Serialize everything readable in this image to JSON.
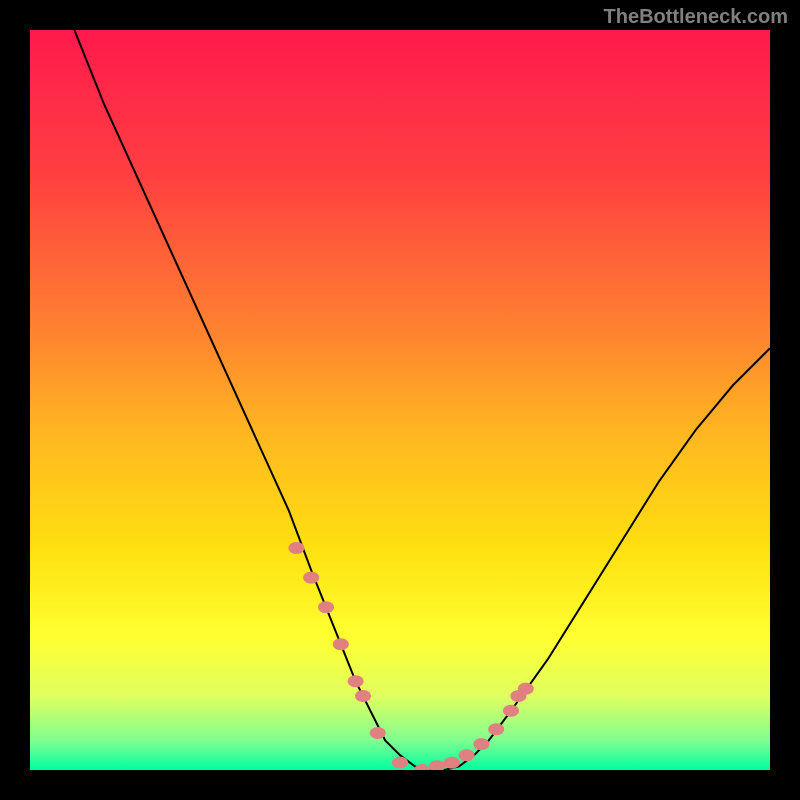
{
  "watermark": "TheBottleneck.com",
  "chart_data": {
    "type": "line",
    "title": "",
    "xlabel": "",
    "ylabel": "",
    "xlim": [
      0,
      100
    ],
    "ylim": [
      0,
      100
    ],
    "series": [
      {
        "name": "curve",
        "x": [
          6,
          10,
          15,
          20,
          25,
          30,
          35,
          38,
          40,
          42,
          44,
          46,
          48,
          50,
          52,
          54,
          56,
          58,
          60,
          62,
          65,
          70,
          75,
          80,
          85,
          90,
          95,
          100
        ],
        "y": [
          100,
          90,
          79,
          68,
          57,
          46,
          35,
          27,
          22,
          17,
          12,
          8,
          4,
          2,
          0.5,
          0,
          0,
          0.5,
          2,
          4,
          8,
          15,
          23,
          31,
          39,
          46,
          52,
          57
        ]
      }
    ],
    "highlights": {
      "name": "dotted-segments",
      "color": "#e08080",
      "x": [
        36,
        38,
        40,
        42,
        44,
        45,
        47,
        50,
        53,
        55,
        57,
        59,
        61,
        63,
        65,
        66,
        67
      ],
      "y": [
        30,
        26,
        22,
        17,
        12,
        10,
        5,
        1,
        0,
        0.5,
        1,
        2,
        3.5,
        5.5,
        8,
        10,
        11
      ]
    },
    "gradient_stops": [
      {
        "offset": 0.0,
        "color": "#ff1a4d"
      },
      {
        "offset": 0.2,
        "color": "#ff4040"
      },
      {
        "offset": 0.4,
        "color": "#ff8030"
      },
      {
        "offset": 0.55,
        "color": "#ffb820"
      },
      {
        "offset": 0.7,
        "color": "#ffe010"
      },
      {
        "offset": 0.82,
        "color": "#ffff30"
      },
      {
        "offset": 0.9,
        "color": "#e0ff60"
      },
      {
        "offset": 0.96,
        "color": "#80ff90"
      },
      {
        "offset": 1.0,
        "color": "#00ffa0"
      }
    ]
  }
}
